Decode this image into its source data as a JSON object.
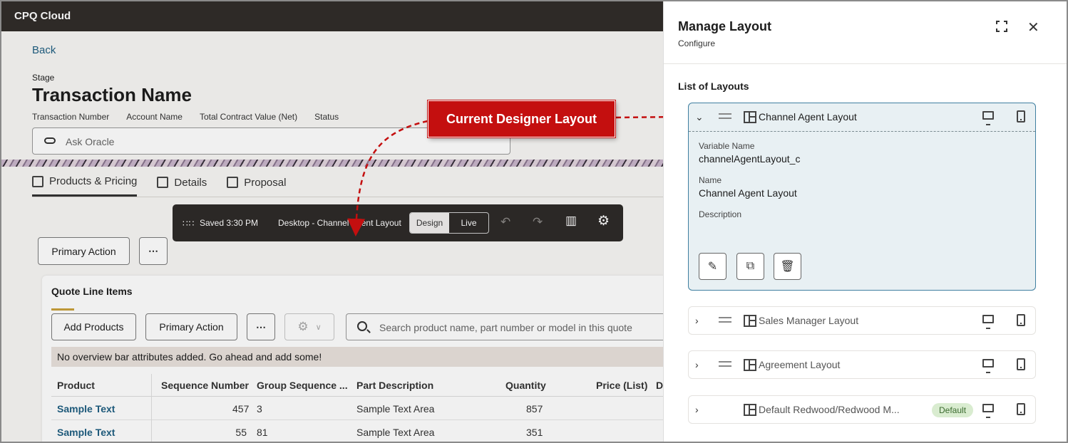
{
  "app": {
    "title": "CPQ Cloud"
  },
  "page": {
    "back_label": "Back",
    "stage_label": "Stage",
    "transaction_title": "Transaction Name",
    "fields": [
      "Transaction Number",
      "Account Name",
      "Total Contract Value (Net)",
      "Status"
    ],
    "ask_placeholder": "Ask Oracle"
  },
  "tabs": [
    {
      "label": "Products & Pricing"
    },
    {
      "label": "Details"
    },
    {
      "label": "Proposal"
    }
  ],
  "toolbar": {
    "primary_action": "Primary Action",
    "more": "⋯"
  },
  "designer": {
    "saved": "Saved 3:30 PM",
    "layout_label": "Desktop - Channel Agent Layout",
    "design": "Design",
    "live": "Live"
  },
  "quote": {
    "title": "Quote Line Items",
    "add_products": "Add Products",
    "primary_action": "Primary Action",
    "more": "⋯",
    "search_placeholder": "Search product name, part number or model in this quote",
    "overview_message": "No overview bar attributes added. Go ahead and add some!",
    "columns": [
      "Product",
      "Sequence Number",
      "Group Sequence ...",
      "Part Description",
      "Quantity",
      "Price (List)",
      "D"
    ],
    "rows": [
      {
        "product": "Sample Text",
        "seq": "457",
        "group": "3",
        "desc": "Sample Text Area",
        "qty": "857"
      },
      {
        "product": "Sample Text",
        "seq": "55",
        "group": "81",
        "desc": "Sample Text Area",
        "qty": "351"
      }
    ]
  },
  "callout": {
    "text": "Current Designer Layout"
  },
  "panel": {
    "title": "Manage Layout",
    "subtitle": "Configure",
    "list_title": "List of Layouts",
    "layouts": [
      {
        "name": "Channel Agent Layout"
      },
      {
        "name": "Sales Manager Layout"
      },
      {
        "name": "Agreement Layout"
      },
      {
        "name": "Default Redwood/Redwood M...",
        "badge": "Default"
      }
    ],
    "detail": {
      "variable_label": "Variable Name",
      "variable_value": "channelAgentLayout_c",
      "name_label": "Name",
      "name_value": "Channel Agent Layout",
      "description_label": "Description"
    }
  },
  "colors": {
    "topbar": "#312d2a",
    "accent_red": "#c40f0f",
    "link": "#1f5f82",
    "selected_bg": "#e8f0f3",
    "selected_border": "#3f7fa0"
  }
}
